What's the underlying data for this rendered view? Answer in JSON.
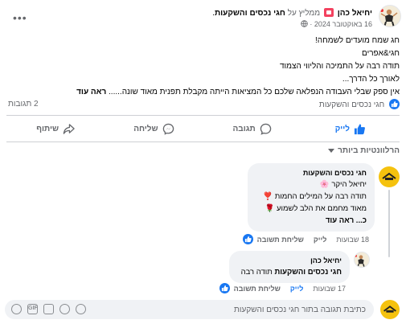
{
  "post": {
    "author": "יחיאל כהן",
    "recommends_text": "ממליץ על",
    "page_name": "חגי נכסים והשקעות",
    "date": "16 באוקטובר 2024",
    "date_separator": "·",
    "lines": [
      "חג שמח מועדים לשמחה!",
      "חגי&אפרים",
      "תודה רבה על התמיכה והליווי הצמוד",
      "לאורך כל הדרך...",
      "אין ספק שבלי העבודה הנפלאה שלכם כל המציאות הייתה מקבלת תפנית מאוד שונה......"
    ],
    "see_more": "ראה עוד",
    "reactors": "חגי נכסים והשקעות",
    "shares": "2 תגובות"
  },
  "actions": {
    "like": "לייק",
    "comment": "תגובה",
    "send": "שליחה",
    "share": "שיתוף"
  },
  "filter_label": "הרלוונטיות ביותר",
  "comments": [
    {
      "author": "חגי נכסים והשקעות",
      "lines": [
        "יחיאל היקר 🌸",
        "תודה רבה על המילים החמות ❣️",
        "מאוד מחמם את הלב לשמוע 🌹",
        "כ... ראה עוד"
      ],
      "time": "18 שבועות",
      "like": "לייק",
      "reply": "שליחת תשובה"
    },
    {
      "author": "יחיאל כהן",
      "mention": "חגי נכסים והשקעות",
      "text": "תודה רבה",
      "time": "17 שבועות",
      "like": "לייק",
      "reply": "שליחת תשובה"
    }
  ],
  "composer": {
    "placeholder": "כתיבת תגובה בתור חגי נכסים והשקעות"
  },
  "colors": {
    "accent": "#1877f2",
    "text_secondary": "#65676b",
    "bubble": "#f0f2f5",
    "brand_yellow": "#f5c20e"
  }
}
